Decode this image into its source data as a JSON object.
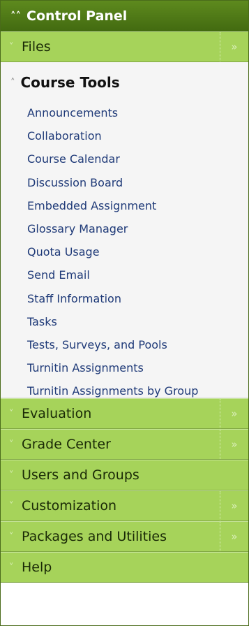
{
  "header": {
    "title": "Control Panel",
    "icon": "double-chevron-up-icon"
  },
  "sections_top": [
    {
      "label": "Files",
      "has_arrow": true
    }
  ],
  "course_tools": {
    "title": "Course Tools",
    "items": [
      "Announcements",
      "Collaboration",
      "Course Calendar",
      "Discussion Board",
      "Embedded Assignment",
      "Glossary Manager",
      "Quota Usage",
      "Send Email",
      "Staff Information",
      "Tasks",
      "Tests, Surveys, and Pools",
      "Turnitin Assignments",
      "Turnitin Assignments by Group"
    ]
  },
  "sections_bottom": [
    {
      "label": "Evaluation",
      "has_arrow": true
    },
    {
      "label": "Grade Center",
      "has_arrow": true
    },
    {
      "label": "Users and Groups",
      "has_arrow": false
    },
    {
      "label": "Customization",
      "has_arrow": true
    },
    {
      "label": "Packages and Utilities",
      "has_arrow": true
    },
    {
      "label": "Help",
      "has_arrow": false
    }
  ],
  "colors": {
    "header_bg": "#4f7c18",
    "section_bg": "#a6d35a",
    "link": "#1f3a78"
  }
}
